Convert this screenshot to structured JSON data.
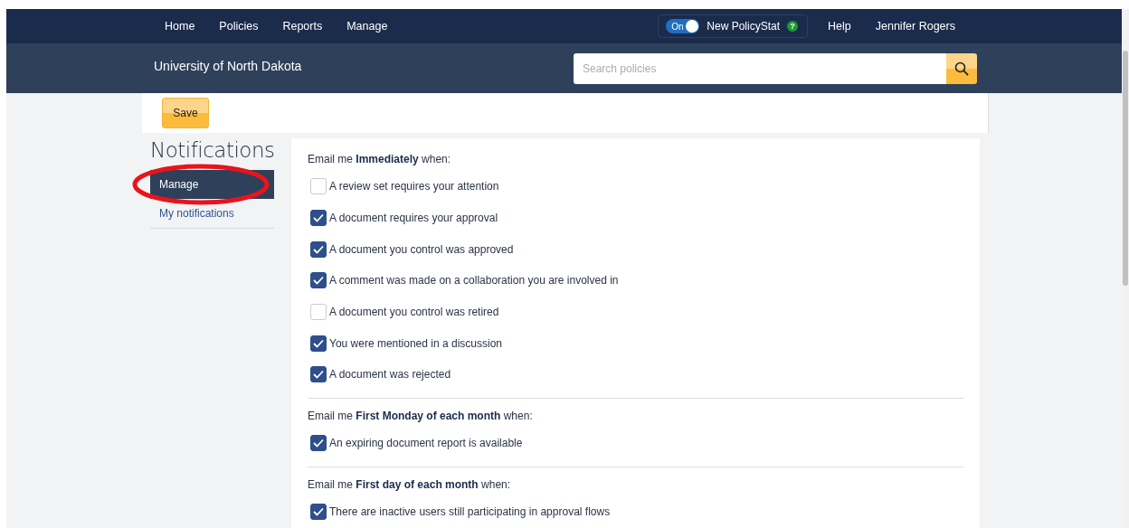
{
  "top_nav": {
    "links": [
      "Home",
      "Policies",
      "Reports",
      "Manage"
    ],
    "toggle": {
      "label": "On",
      "on": true,
      "text": "New PolicyStat",
      "help": "?"
    },
    "help": "Help",
    "user": "Jennifer Rogers"
  },
  "header": {
    "title": "University of North Dakota",
    "search": {
      "placeholder": "Search policies"
    }
  },
  "toolbar": {
    "save": "Save"
  },
  "sidebar": {
    "title": "Notifications",
    "items": [
      {
        "label": "Manage",
        "selected": true,
        "circled": true
      },
      {
        "label": "My notifications",
        "selected": false,
        "circled": false
      }
    ]
  },
  "sections": [
    {
      "intro": "Email me **Immediately** when:",
      "options": [
        {
          "label": "A review set requires your attention",
          "checked": false
        },
        {
          "label": "A document requires your approval",
          "checked": true
        },
        {
          "label": "A document you control was approved",
          "checked": true
        },
        {
          "label": "A comment was made on a collaboration you are involved in",
          "checked": true
        },
        {
          "label": "A document you control was retired",
          "checked": false
        },
        {
          "label": "You were mentioned in a discussion",
          "checked": true
        },
        {
          "label": "A document was rejected",
          "checked": true
        }
      ]
    },
    {
      "intro": "Email me **First Monday of each month** when:",
      "options": [
        {
          "label": "An expiring document report is available",
          "checked": true
        }
      ]
    },
    {
      "intro": "Email me **First day of each month** when:",
      "options": [
        {
          "label": "There are inactive users still participating in approval flows",
          "checked": true
        }
      ]
    }
  ]
}
